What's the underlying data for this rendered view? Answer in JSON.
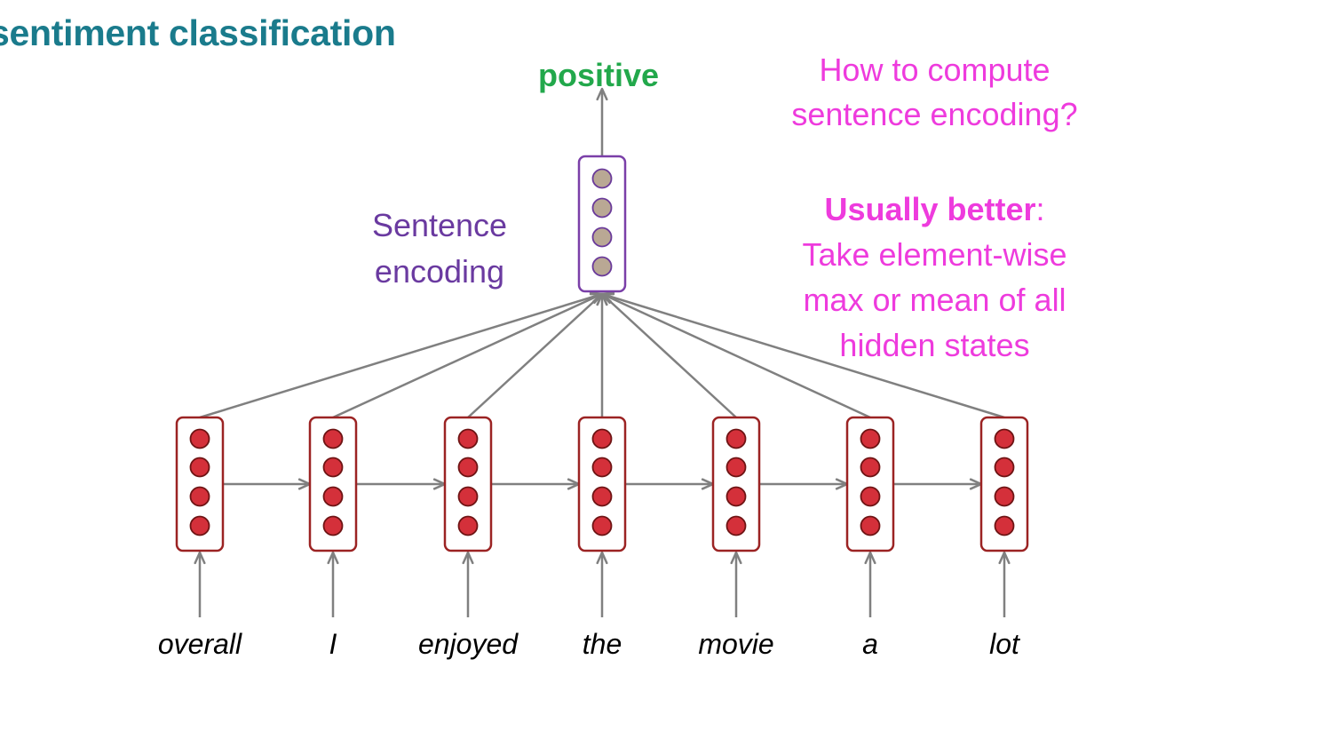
{
  "title": "sentiment classification",
  "output_label": "positive",
  "encoding_label": [
    "Sentence",
    "encoding"
  ],
  "question": [
    "How to compute",
    "sentence encoding?"
  ],
  "note": {
    "bold": "Usually better",
    "colon": ":",
    "lines": [
      "Take element-wise",
      "max or mean of all",
      "hidden states"
    ]
  },
  "words": [
    "overall",
    "I",
    "enjoyed",
    "the",
    "movie",
    "a",
    "lot"
  ],
  "colors": {
    "title": "#1a7b8c",
    "output": "#22a84b",
    "encoding_box": "#7a3fa8",
    "encoding_dot": "#b9a894",
    "hidden_box": "#9b2323",
    "hidden_dot": "#d4303a",
    "arrow": "#808080",
    "annotation": "#ee3bdd"
  }
}
